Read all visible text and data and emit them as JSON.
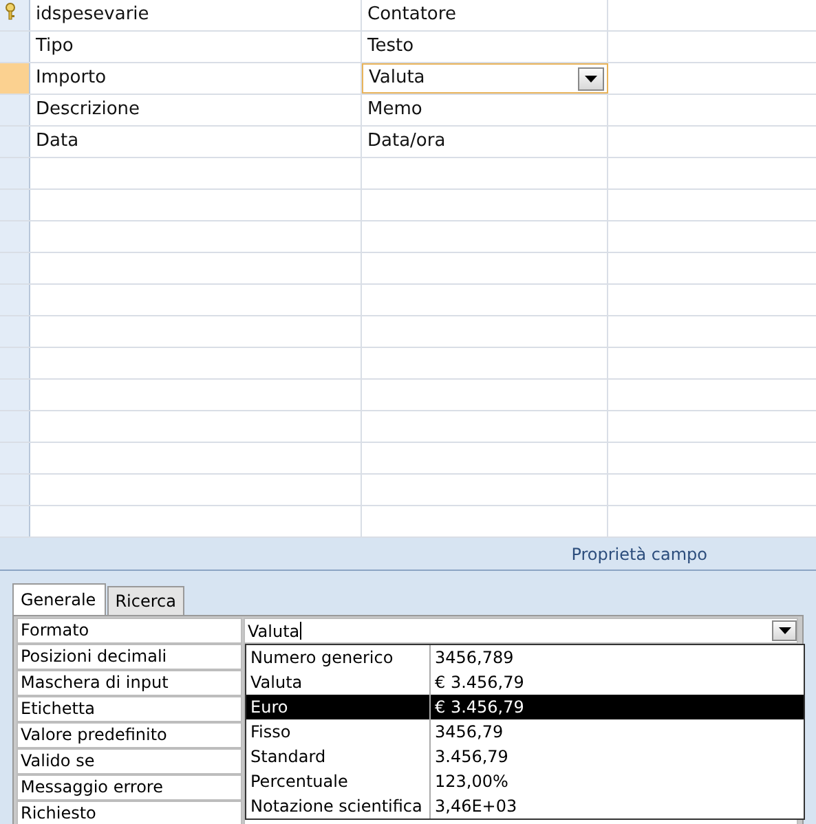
{
  "fields": [
    {
      "name": "idspesevarie",
      "type": "Contatore",
      "primary_key": true,
      "selected": false
    },
    {
      "name": "Tipo",
      "type": "Testo",
      "primary_key": false,
      "selected": false
    },
    {
      "name": "Importo",
      "type": "Valuta",
      "primary_key": false,
      "selected": true
    },
    {
      "name": "Descrizione",
      "type": "Memo",
      "primary_key": false,
      "selected": false
    },
    {
      "name": "Data",
      "type": "Data/ora",
      "primary_key": false,
      "selected": false
    }
  ],
  "properties_header": "Proprietà campo",
  "tabs": [
    {
      "label": "Generale",
      "selected": true
    },
    {
      "label": "Ricerca",
      "selected": false
    }
  ],
  "properties": [
    {
      "label": "Formato",
      "value": "Valuta"
    },
    {
      "label": "Posizioni decimali"
    },
    {
      "label": "Maschera di input"
    },
    {
      "label": "Etichetta"
    },
    {
      "label": "Valore predefinito"
    },
    {
      "label": "Valido se"
    },
    {
      "label": "Messaggio errore"
    },
    {
      "label": "Richiesto"
    }
  ],
  "format_options": [
    {
      "name": "Numero generico",
      "example": "3456,789",
      "selected": false
    },
    {
      "name": "Valuta",
      "example": "€ 3.456,79",
      "selected": false
    },
    {
      "name": "Euro",
      "example": "€ 3.456,79",
      "selected": true
    },
    {
      "name": "Fisso",
      "example": "3456,79",
      "selected": false
    },
    {
      "name": "Standard",
      "example": "3.456,79",
      "selected": false
    },
    {
      "name": "Percentuale",
      "example": "123,00%",
      "selected": false
    },
    {
      "name": "Notazione scientifica",
      "example": "3,46E+03",
      "selected": false
    }
  ]
}
